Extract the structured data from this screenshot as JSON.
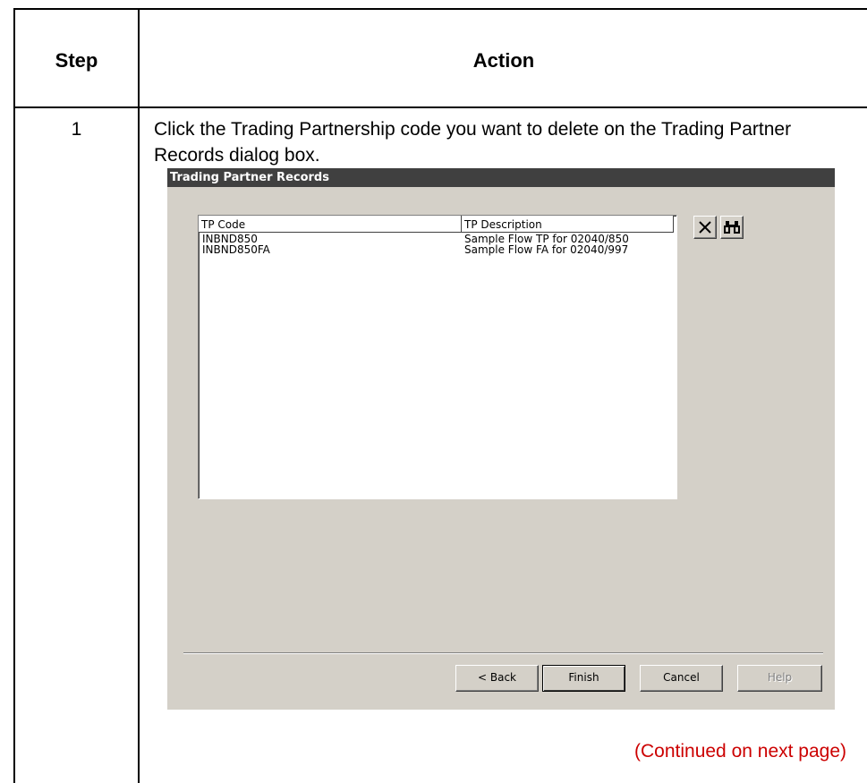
{
  "table": {
    "step_header": "Step",
    "action_header": "Action",
    "step_number": "1",
    "instruction": "Click the Trading Partnership code you want to delete on the Trading Partner Records dialog box.",
    "continued": "(Continued on next page)"
  },
  "dialog": {
    "title": "Trading Partner Records",
    "columns": [
      "TP Code",
      "TP Description"
    ],
    "rows": [
      {
        "code": "INBND850",
        "description": "Sample Flow TP for 02040/850"
      },
      {
        "code": "INBND850FA",
        "description": "Sample Flow FA for 02040/997"
      }
    ],
    "icons": {
      "delete": "delete-x-icon",
      "find": "binoculars-icon"
    },
    "buttons": {
      "back": "< Back",
      "finish": "Finish",
      "cancel": "Cancel",
      "help": "Help"
    }
  }
}
